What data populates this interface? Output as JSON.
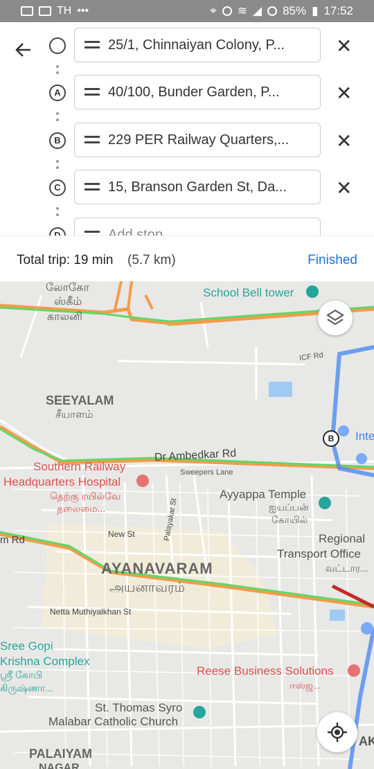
{
  "status_bar": {
    "network": "TH",
    "more": "•••",
    "battery": "85%",
    "time": "17:52"
  },
  "header": {
    "back_icon": "arrow-left-icon"
  },
  "stops": [
    {
      "marker": "",
      "text": "25/1, Chinnaiyan Colony, P..."
    },
    {
      "marker": "A",
      "text": "40/100, Bunder Garden, P..."
    },
    {
      "marker": "B",
      "text": "229 PER Railway Quarters,..."
    },
    {
      "marker": "C",
      "text": "15, Branson Garden St, Da..."
    },
    {
      "marker": "D",
      "text": "Add stop"
    }
  ],
  "summary": {
    "label": "Total trip: 19 min",
    "distance": "(5.7 km)",
    "finished": "Finished"
  },
  "map": {
    "labels": {
      "lokomo": "லோகோ",
      "scheme": "ஸ்கீம்",
      "colony": "காலனி",
      "school": "School Bell tower",
      "icf": "ICF Rd",
      "seeyalam": "SEEYALAM",
      "seeyalam_ta": "சீயாளம்",
      "inte": "Inte",
      "southern": "Southern Railway",
      "hq": "Headquarters Hospital",
      "hq_ta1": "தெற்கு ரயில்வே",
      "hq_ta2": "தலைமை...",
      "ambedkar": "Dr Ambedkar Rd",
      "sweepers": "Sweepers Lane",
      "ayyappa": "Ayyappa Temple",
      "ayyappa_ta1": "ஐயப்பன்",
      "ayyappa_ta2": "கோயில்",
      "newst": "New St",
      "palayakar": "Palayakar St",
      "mrd": "m Rd",
      "regional": "Regional",
      "transport": "Transport Office",
      "vattara": "வட்டார...",
      "ayanavaram": "AYANAVARAM",
      "ayanavaram_ta": "அயனாவரம்",
      "netta": "Netta Muthiyalkhan St",
      "sree": "Sree Gopi",
      "krishna": "Krishna Complex",
      "sree_ta1": "ஸ்ரீ கோபி",
      "sree_ta2": "கிருஷ்ணா...",
      "reese": "Reese Business Solutions",
      "reese_ta": "ஈஸ்ஜ...",
      "thomas": "St. Thomas Syro",
      "malabar": "Malabar Catholic Church",
      "palaiyam": "PALAIYAM",
      "nagar": "NAGAR",
      "ak": "AK",
      "b_marker": "B"
    },
    "colors": {
      "route": "#7baaf7",
      "traffic_green": "#63d668",
      "traffic_orange": "#f29c4a",
      "poi_red": "#e57373",
      "poi_teal": "#26a69a"
    },
    "icons": [
      "layers-icon",
      "my-location-icon"
    ]
  }
}
